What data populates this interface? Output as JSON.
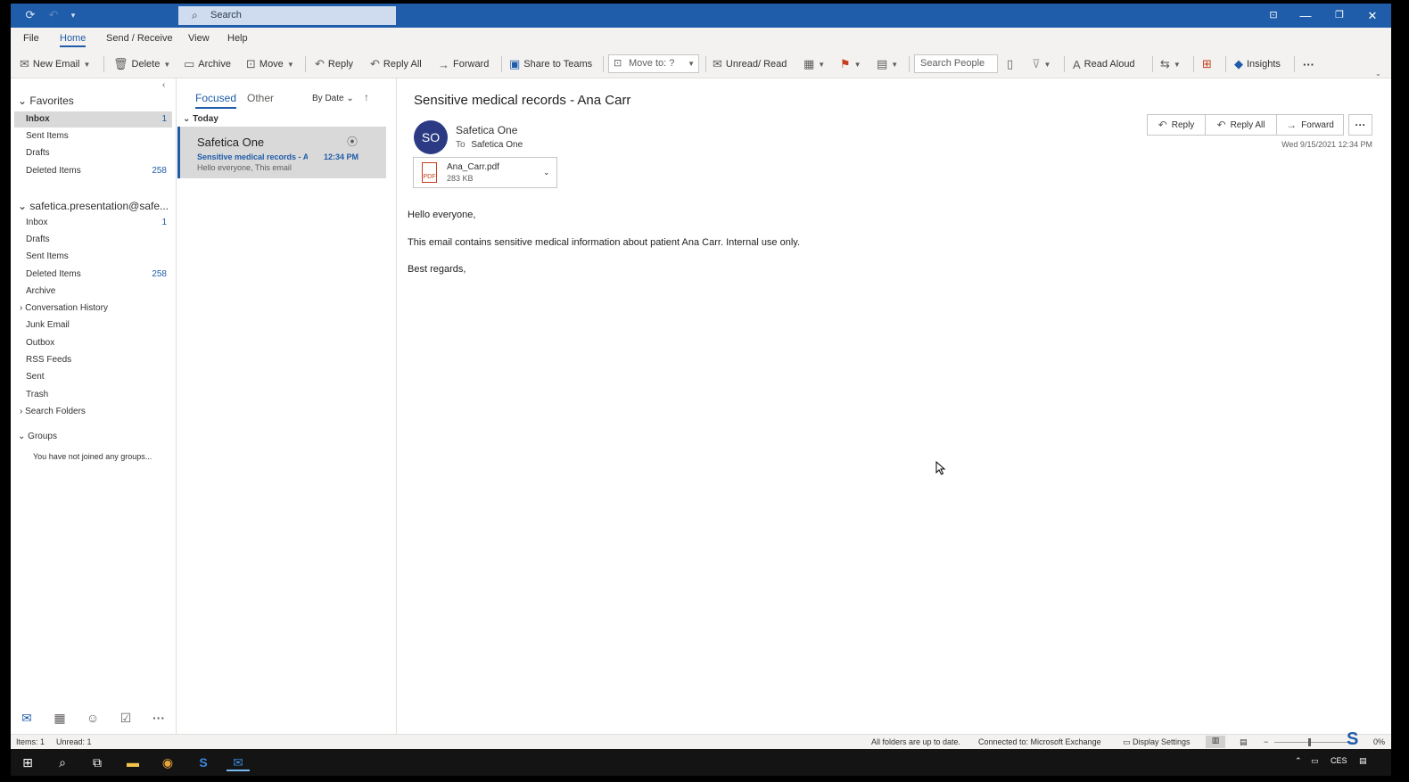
{
  "title_bar": {
    "search_label": "Search"
  },
  "menu": {
    "tabs": [
      "File",
      "Home",
      "Send / Receive",
      "View",
      "Help"
    ],
    "active_tab": "Home"
  },
  "ribbon": {
    "new_email": "New Email",
    "delete": "Delete",
    "archive": "Archive",
    "move": "Move",
    "reply": "Reply",
    "reply_all": "Reply All",
    "forward": "Forward",
    "share_to_teams": "Share to Teams",
    "move_to": "Move to: ?",
    "unread_read": "Unread/ Read",
    "search_people": "Search People",
    "read_aloud": "Read Aloud",
    "insights": "Insights",
    "more": "···"
  },
  "folders": {
    "favorites_label": "Favorites",
    "favorites": [
      {
        "name": "Inbox",
        "count": "1"
      },
      {
        "name": "Sent Items",
        "count": ""
      },
      {
        "name": "Drafts",
        "count": ""
      },
      {
        "name": "Deleted Items",
        "count": "258"
      }
    ],
    "account_label": "safetica.presentation@safe...",
    "account_folders": [
      {
        "name": "Inbox",
        "count": "1"
      },
      {
        "name": "Drafts",
        "count": ""
      },
      {
        "name": "Sent Items",
        "count": ""
      },
      {
        "name": "Deleted Items",
        "count": "258"
      },
      {
        "name": "Archive",
        "count": ""
      },
      {
        "name": "Conversation History",
        "count": ""
      },
      {
        "name": "Junk Email",
        "count": ""
      },
      {
        "name": "Outbox",
        "count": ""
      },
      {
        "name": "RSS Feeds",
        "count": ""
      },
      {
        "name": "Sent",
        "count": ""
      },
      {
        "name": "Trash",
        "count": ""
      },
      {
        "name": "Search Folders",
        "count": ""
      }
    ],
    "groups_label": "Groups",
    "groups_empty": "You have not joined any groups..."
  },
  "message_list": {
    "tab_focused": "Focused",
    "tab_other": "Other",
    "sort": "By Date",
    "group": "Today",
    "item": {
      "sender": "Safetica One",
      "subject": "Sensitive medical records - Ana Carr",
      "time": "12:34 PM",
      "preview": "Hello everyone,  This email"
    }
  },
  "reading_pane": {
    "subject": "Sensitive medical records - Ana Carr",
    "avatar_initials": "SO",
    "from": "Safetica One",
    "to_label": "To",
    "to": "Safetica One",
    "attachment_name": "Ana_Carr.pdf",
    "attachment_size": "283 KB",
    "attachment_type": "PDF",
    "date": "Wed 9/15/2021 12:34 PM",
    "btn_reply": "Reply",
    "btn_reply_all": "Reply All",
    "btn_forward": "Forward",
    "body": [
      "Hello everyone,",
      "This email contains sensitive medical information about patient Ana Carr. Internal use only.",
      "Best regards,"
    ]
  },
  "status_bar": {
    "items": "Items: 1",
    "unread": "Unread: 1",
    "sync": "All folders are up to date.",
    "connection": "Connected to: Microsoft Exchange",
    "display_settings": "Display Settings",
    "zoom": "0%"
  },
  "taskbar": {
    "language": "CES"
  },
  "colors": {
    "accent": "#1f5ca9",
    "avatar": "#2b3a83"
  }
}
